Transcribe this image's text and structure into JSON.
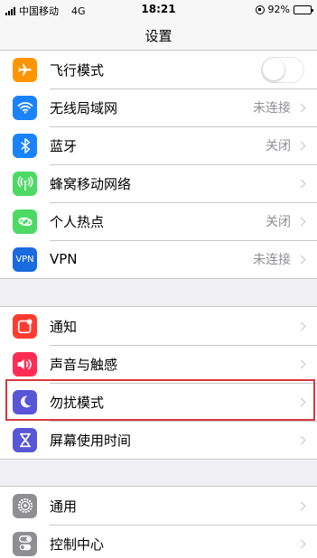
{
  "status_bar": {
    "carrier": "中国移动",
    "network": "4G",
    "time": "18:21",
    "battery_label": "92%",
    "battery_level": 0.92
  },
  "nav": {
    "title": "设置"
  },
  "groups": [
    {
      "rows": [
        {
          "label": "飞行模式",
          "icon": "airplane-icon",
          "color": "#ff9500",
          "control": "toggle",
          "toggle_on": false
        },
        {
          "label": "无线局域网",
          "icon": "wifi-icon",
          "color": "#1a82fb",
          "value": "未连接"
        },
        {
          "label": "蓝牙",
          "icon": "bluetooth-icon",
          "color": "#1a82fb",
          "value": "关闭"
        },
        {
          "label": "蜂窝移动网络",
          "icon": "cellular-icon",
          "color": "#4cd964",
          "value": ""
        },
        {
          "label": "个人热点",
          "icon": "hotspot-icon",
          "color": "#4cd964",
          "value": "关闭"
        },
        {
          "label": "VPN",
          "icon": "vpn-icon",
          "color": "#1a6ae0",
          "value": "未连接",
          "icon_text": "VPN"
        }
      ]
    },
    {
      "rows": [
        {
          "label": "通知",
          "icon": "notifications-icon",
          "color": "#ff3b30"
        },
        {
          "label": "声音与触感",
          "icon": "sound-icon",
          "color": "#ff2d55"
        },
        {
          "label": "勿扰模式",
          "icon": "moon-icon",
          "color": "#5856d6"
        },
        {
          "label": "屏幕使用时间",
          "icon": "hourglass-icon",
          "color": "#5856d6"
        }
      ]
    },
    {
      "rows": [
        {
          "label": "通用",
          "icon": "gear-icon",
          "color": "#8e8e93"
        },
        {
          "label": "控制中心",
          "icon": "control-center-icon",
          "color": "#8e8e93"
        }
      ]
    }
  ]
}
